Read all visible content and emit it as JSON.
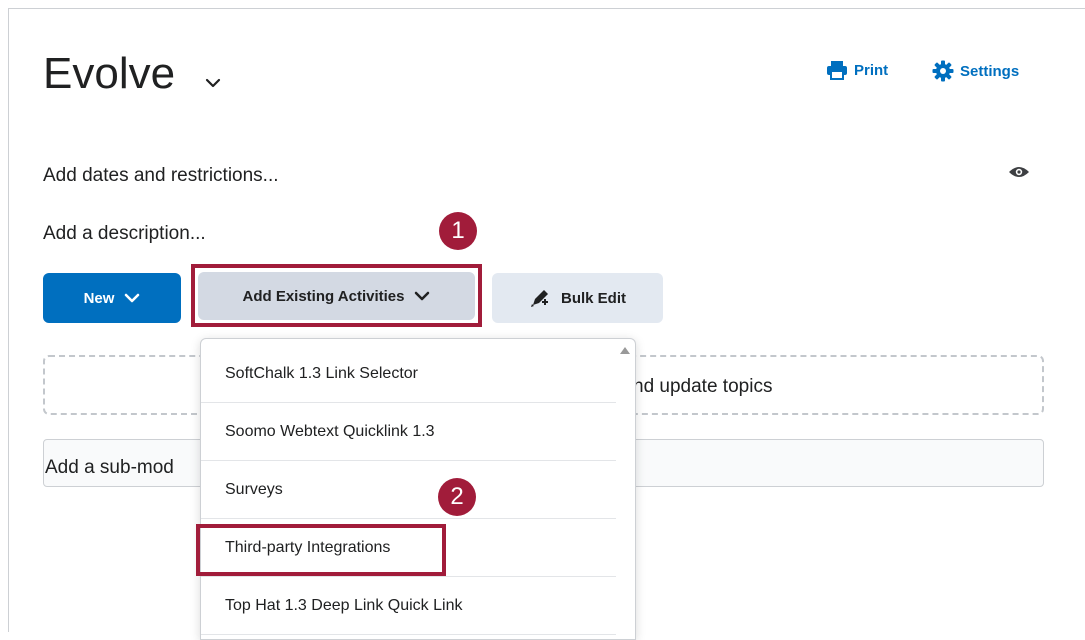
{
  "page": {
    "title": "Evolve",
    "print_label": "Print",
    "settings_label": "Settings",
    "dates_restrictions": "Add dates and restrictions...",
    "description": "Add a description...",
    "drop_zone_text": "nd update topics",
    "submodule_placeholder": "Add a sub-mod"
  },
  "toolbar": {
    "new_label": "New",
    "add_existing_label": "Add Existing Activities",
    "bulk_edit_label": "Bulk Edit"
  },
  "dropdown": {
    "items": [
      "SoftChalk 1.3 Link Selector",
      "Soomo Webtext Quicklink 1.3",
      "Surveys",
      "Third-party Integrations",
      "Top Hat 1.3 Deep Link Quick Link"
    ]
  },
  "annotations": {
    "step1": "1",
    "step2": "2",
    "highlight_color": "#a11c3a"
  },
  "colors": {
    "primary": "#006fbf",
    "text": "#202122"
  },
  "icons": {
    "print": "printer-icon",
    "settings": "gear-icon",
    "visibility": "eye-icon",
    "bulk_edit": "pencil-icon"
  }
}
